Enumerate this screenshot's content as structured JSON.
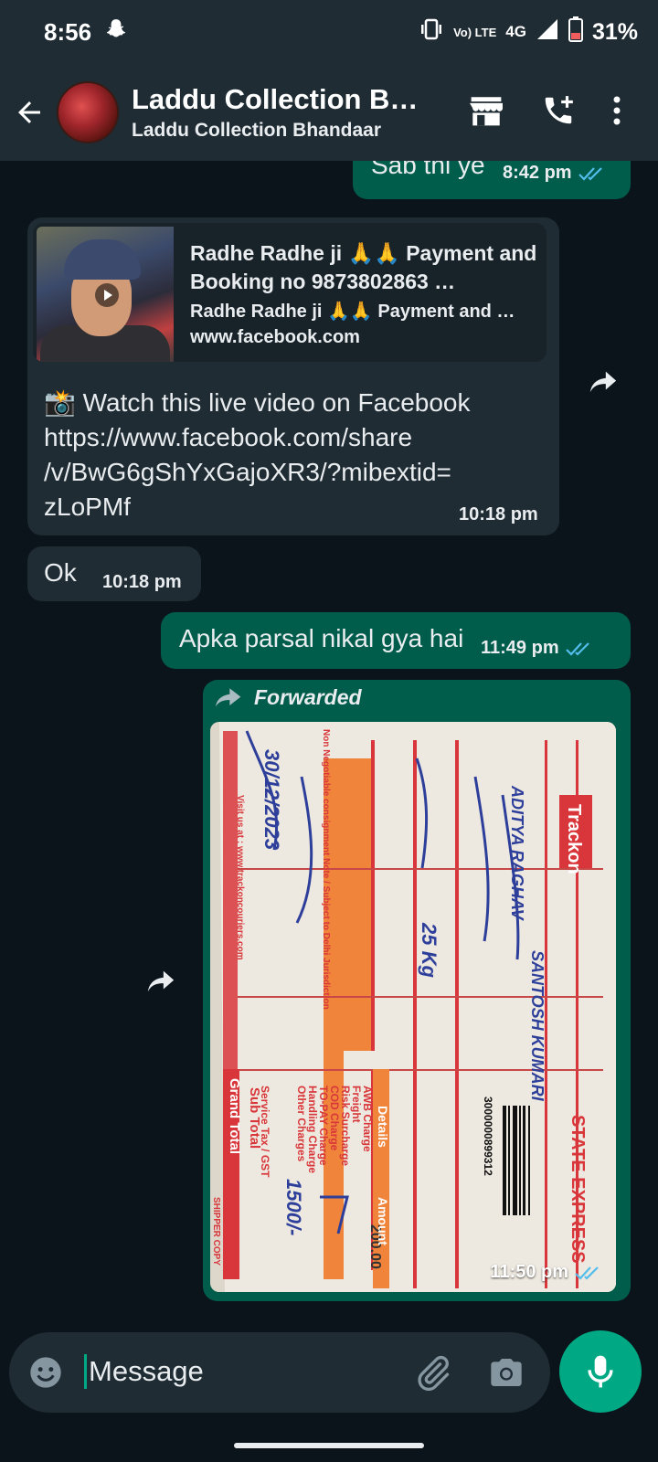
{
  "status_bar": {
    "time": "8:56",
    "volte": "Vo) LTE",
    "network": "4G",
    "battery": "31%"
  },
  "header": {
    "title": "Laddu Collection B…",
    "subtitle": "Laddu Collection Bhandaar"
  },
  "messages": [
    {
      "text": "Sab thi ye",
      "time": "8:42 pm",
      "status": "read"
    },
    {
      "link_preview": {
        "title": "Radhe Radhe ji 🙏🙏 Payment and Booking no 9873802863 …",
        "description": "Radhe Radhe ji 🙏🙏 Payment and …",
        "domain": "www.facebook.com"
      },
      "text_line1": "📸 Watch this live video on Facebook",
      "text_line2": "https://www.facebook.com/share",
      "text_line3": "/v/BwG6gShYxGajoXR3/?mibextid=",
      "text_line4": "zLoPMf",
      "time": "10:18 pm"
    },
    {
      "text": "Ok",
      "time": "10:18 pm"
    },
    {
      "text": "Apka parsal nikal gya hai",
      "time": "11:49 pm",
      "status": "read"
    },
    {
      "forwarded_label": "Forwarded",
      "photo_text": {
        "brand": "Trackon",
        "company": "STATE EXPRESS",
        "date": "30/12/2023",
        "consignor": "ADITYA RAGHAV",
        "consignee": "SANTOSH KUMARI",
        "weight": "25 Kg",
        "amount": "200.00",
        "grand_total": "1500/-",
        "barcode": "3000000899312",
        "header_note": "Non Negotiable consignment Note / Subject to Delhi Jurisdiction",
        "details_heading": "Details",
        "amount_heading": "Amount",
        "grand_total_heading": "Grand Total",
        "sub_total_heading": "Sub Total",
        "shipper_copy": "SHIPPER COPY",
        "website": "Visit us at : www.trackoncouriers.com",
        "charges": [
          "AWB Charge",
          "Freight",
          "Risk Surcharge",
          "COD Charge",
          "TO-PAY Charge",
          "Handling Charge",
          "Other Charges",
          "Service Tax / GST"
        ]
      },
      "time": "11:50 pm",
      "status": "read"
    }
  ],
  "input": {
    "placeholder": "Message"
  },
  "colors": {
    "outgoing_bubble": "#005c4b",
    "incoming_bubble": "#1f2c34",
    "accent": "#00a884",
    "read_tick": "#53bdeb",
    "background": "#0b141a"
  },
  "icons": [
    "back-arrow-icon",
    "store-icon",
    "add-call-icon",
    "more-vert-icon",
    "forward-icon",
    "emoji-icon",
    "attach-icon",
    "camera-icon",
    "mic-icon",
    "double-tick-icon",
    "snapchat-icon",
    "vibrate-icon",
    "signal-icon",
    "battery-icon"
  ]
}
